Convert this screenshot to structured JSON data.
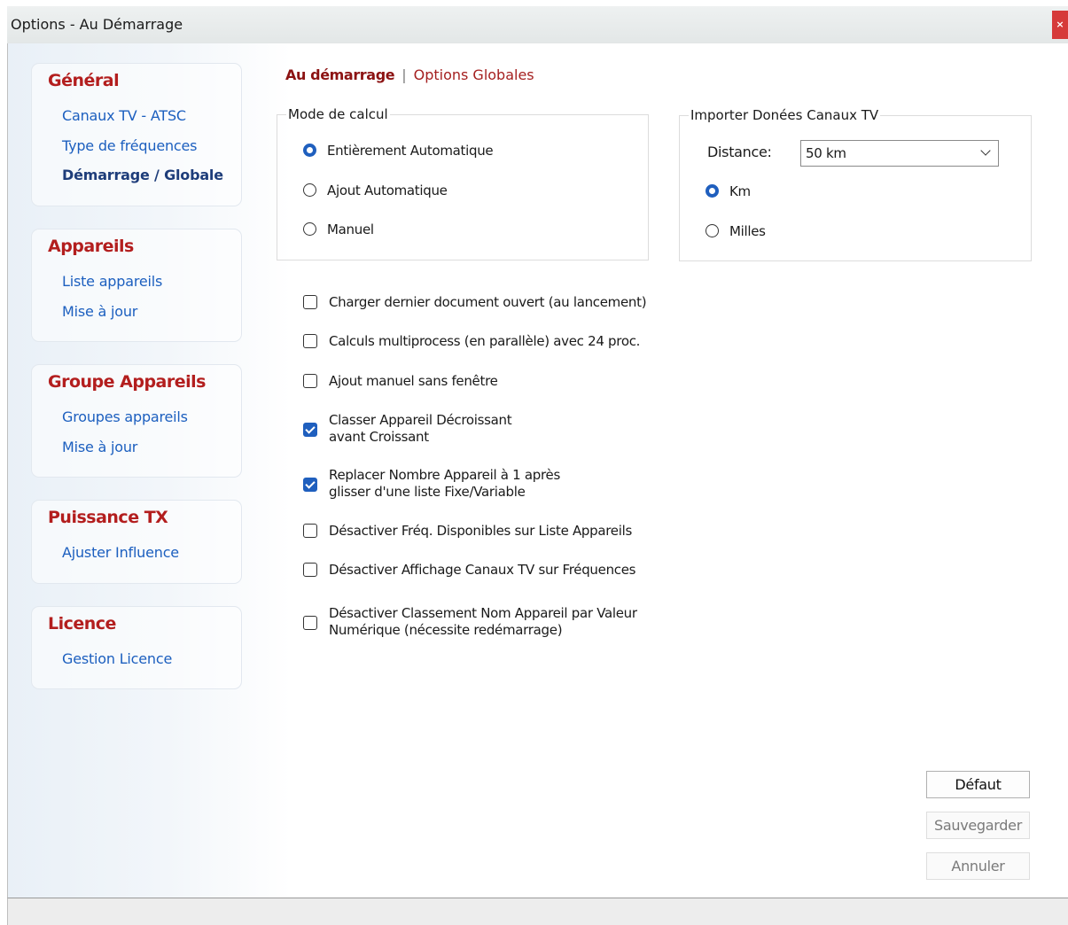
{
  "window": {
    "title": "Options - Au Démarrage",
    "close_label": "×"
  },
  "sidebar": {
    "groups": [
      {
        "title": "Général",
        "items": [
          {
            "label": "Canaux TV - ATSC"
          },
          {
            "label": "Type de fréquences"
          },
          {
            "label": "Démarrage / Globale",
            "active": true
          }
        ]
      },
      {
        "title": "Appareils",
        "items": [
          {
            "label": "Liste appareils"
          },
          {
            "label": "Mise à jour"
          }
        ]
      },
      {
        "title": "Groupe Appareils",
        "items": [
          {
            "label": "Groupes appareils"
          },
          {
            "label": "Mise à jour"
          }
        ]
      },
      {
        "title": "Puissance TX",
        "items": [
          {
            "label": "Ajuster Influence"
          }
        ]
      },
      {
        "title": "Licence",
        "items": [
          {
            "label": "Gestion Licence"
          }
        ]
      }
    ]
  },
  "tabs": {
    "active": "Au démarrage",
    "separator": "|",
    "other": "Options Globales"
  },
  "mode_calcul": {
    "legend": "Mode de calcul",
    "options": [
      {
        "label": "Entièrement Automatique",
        "selected": true
      },
      {
        "label": "Ajout Automatique",
        "selected": false
      },
      {
        "label": "Manuel",
        "selected": false
      }
    ]
  },
  "import_tv": {
    "legend": "Importer Donées Canaux TV",
    "distance_label": "Distance:",
    "distance_value": "50 km",
    "units": [
      {
        "label": "Km",
        "selected": true
      },
      {
        "label": "Milles",
        "selected": false
      }
    ]
  },
  "options": [
    {
      "line1": "Charger dernier document ouvert (au lancement)",
      "line2": "",
      "checked": false
    },
    {
      "line1": "Calculs multiprocess (en parallèle) avec 24 proc.",
      "line2": "",
      "checked": false
    },
    {
      "line1": "Ajout manuel sans fenêtre",
      "line2": "",
      "checked": false
    },
    {
      "line1": "Classer Appareil Décroissant",
      "line2": "avant Croissant",
      "checked": true
    },
    {
      "line1": "Replacer Nombre Appareil à 1 après",
      "line2": "glisser d'une liste Fixe/Variable",
      "checked": true
    },
    {
      "line1": "Désactiver Fréq. Disponibles sur Liste Appareils",
      "line2": "",
      "checked": false
    },
    {
      "line1": "Désactiver Affichage Canaux TV sur Fréquences",
      "line2": "",
      "checked": false
    },
    {
      "line1": "Désactiver Classement Nom Appareil par Valeur",
      "line2": "Numérique (nécessite redémarrage)",
      "checked": false
    }
  ],
  "buttons": {
    "default": "Défaut",
    "save": "Sauvegarder",
    "cancel": "Annuler"
  },
  "colors": {
    "accent": "#b31e1e",
    "link": "#1c5fbe",
    "check": "#1f5fbe"
  }
}
